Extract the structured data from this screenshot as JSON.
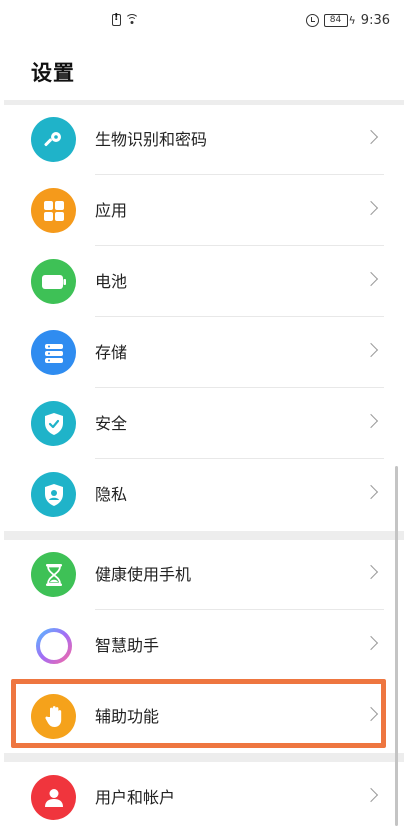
{
  "status_bar": {
    "time": "9:36",
    "battery": "84"
  },
  "header": {
    "title": "设置"
  },
  "items": [
    {
      "label": "生物识别和密码",
      "icon": "key-icon",
      "color": "#1fb3c9"
    },
    {
      "label": "应用",
      "icon": "apps-grid-icon",
      "color": "#f59a1b"
    },
    {
      "label": "电池",
      "icon": "battery-icon",
      "color": "#3ec156"
    },
    {
      "label": "存储",
      "icon": "storage-icon",
      "color": "#2f8cf0"
    },
    {
      "label": "安全",
      "icon": "shield-check-icon",
      "color": "#1fb3c9"
    },
    {
      "label": "隐私",
      "icon": "privacy-shield-icon",
      "color": "#1fb3c9"
    },
    {
      "label": "健康使用手机",
      "icon": "hourglass-icon",
      "color": "#3ec156"
    },
    {
      "label": "智慧助手",
      "icon": "assistant-ring-icon",
      "color": "#9a6af0"
    },
    {
      "label": "辅助功能",
      "icon": "hand-icon",
      "color": "#f5a21b"
    },
    {
      "label": "用户和帐户",
      "icon": "user-icon",
      "color": "#f0353d"
    }
  ],
  "highlight_color": "#ee7640"
}
